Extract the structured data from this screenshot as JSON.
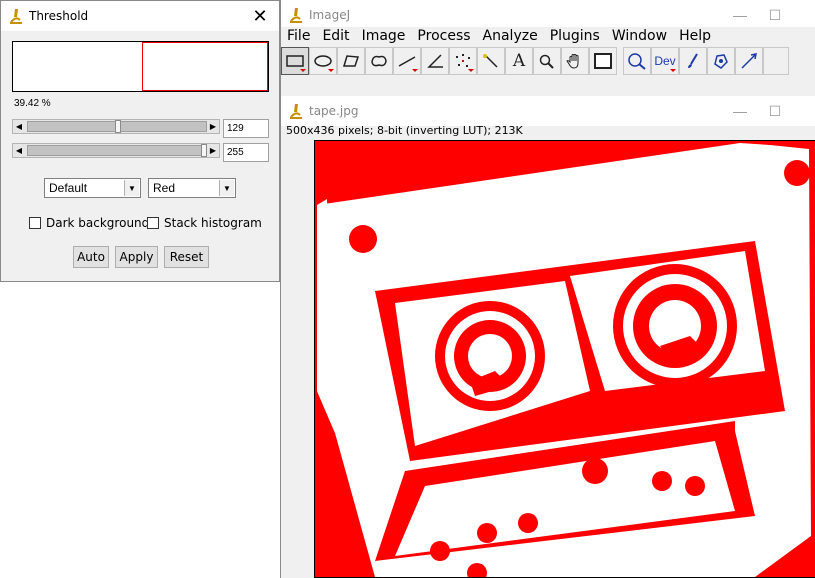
{
  "threshold_dialog": {
    "title": "Threshold",
    "percent": "39.42 %",
    "lower_value": "129",
    "upper_value": "255",
    "lower_slider_fraction": 0.506,
    "upper_slider_fraction": 1.0,
    "method": "Default",
    "display_mode": "Red",
    "dark_background_label": "Dark background",
    "stack_histogram_label": "Stack histogram",
    "auto_label": "Auto",
    "apply_label": "Apply",
    "reset_label": "Reset",
    "threshold_color": "#ff0000"
  },
  "imagej": {
    "title": "ImageJ",
    "menus": [
      "File",
      "Edit",
      "Image",
      "Process",
      "Analyze",
      "Plugins",
      "Window",
      "Help"
    ],
    "tools": [
      "rectangle-icon",
      "oval-icon",
      "polygon-icon",
      "freehand-icon",
      "line-icon",
      "angle-icon",
      "point-icon",
      "wand-icon",
      "text-icon",
      "magnifier-icon",
      "hand-icon",
      "color-picker-icon",
      "zoom-icon",
      "dev-icon",
      "brush-icon",
      "flood-fill-icon",
      "arrow-icon"
    ],
    "dev_label": "Dev",
    "text_tool_label": "A"
  },
  "image_window": {
    "title": "tape.jpg",
    "info": "500x436 pixels; 8-bit (inverting LUT); 213K",
    "foreground_color": "#ffffff",
    "background_color": "#ff0000"
  }
}
